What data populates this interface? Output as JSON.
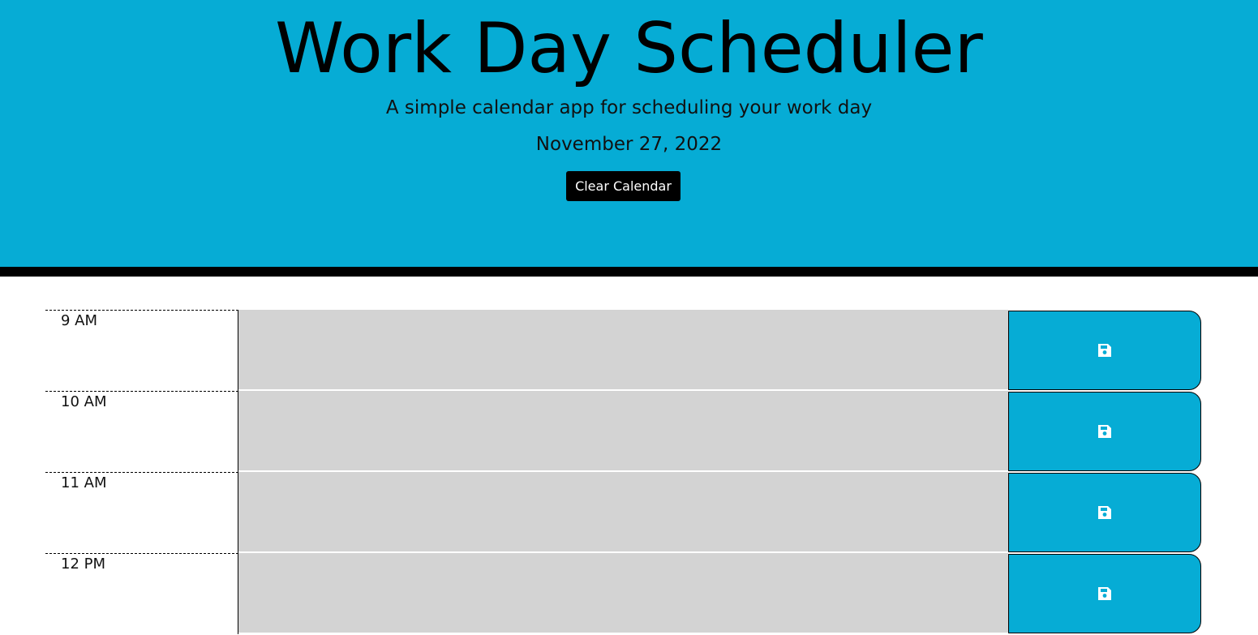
{
  "header": {
    "title": "Work Day Scheduler",
    "subtitle": "A simple calendar app for scheduling your work day",
    "date": "November 27, 2022",
    "clear_label": "Clear Calendar"
  },
  "schedule": {
    "rows": [
      {
        "hour": "9 AM",
        "description": "",
        "save_icon": "save-icon"
      },
      {
        "hour": "10 AM",
        "description": "",
        "save_icon": "save-icon"
      },
      {
        "hour": "11 AM",
        "description": "",
        "save_icon": "save-icon"
      },
      {
        "hour": "12 PM",
        "description": "",
        "save_icon": "save-icon"
      }
    ]
  },
  "colors": {
    "header_bg": "#06acd5",
    "header_border": "#000000",
    "description_bg": "#d3d3d3",
    "save_bg": "#06acd5",
    "clear_bg": "#000000"
  }
}
